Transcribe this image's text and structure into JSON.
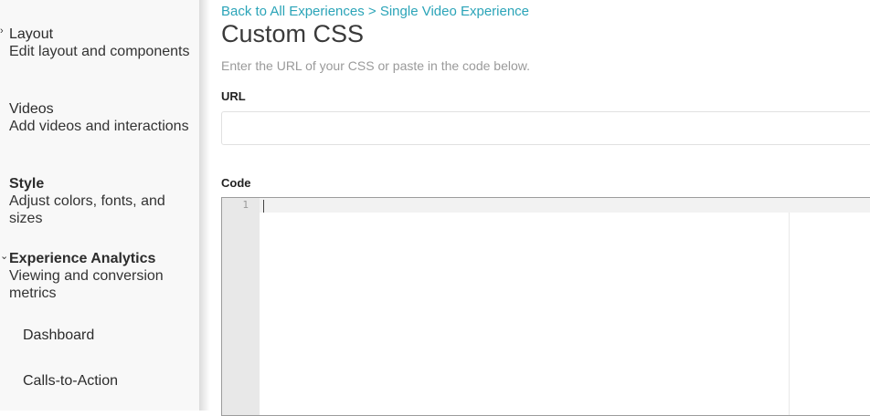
{
  "sidebar": {
    "items": [
      {
        "title": "Layout",
        "description": "Edit layout and components",
        "bold": false
      },
      {
        "title": "Videos",
        "description": "Add videos and interactions",
        "bold": false
      },
      {
        "title": "Style",
        "description": "Adjust colors, fonts, and sizes",
        "bold": true
      },
      {
        "title": "Experience Analytics",
        "description": "Viewing and conversion metrics",
        "bold": true
      }
    ],
    "subitems": [
      "Dashboard",
      "Calls-to-Action"
    ]
  },
  "main": {
    "breadcrumb": "Back to All Experiences > Single Video Experience",
    "title": "Custom CSS",
    "instructions": "Enter the URL of your CSS or paste in the code below.",
    "url_label": "URL",
    "url_value": "",
    "code_label": "Code",
    "line_number": "1"
  }
}
